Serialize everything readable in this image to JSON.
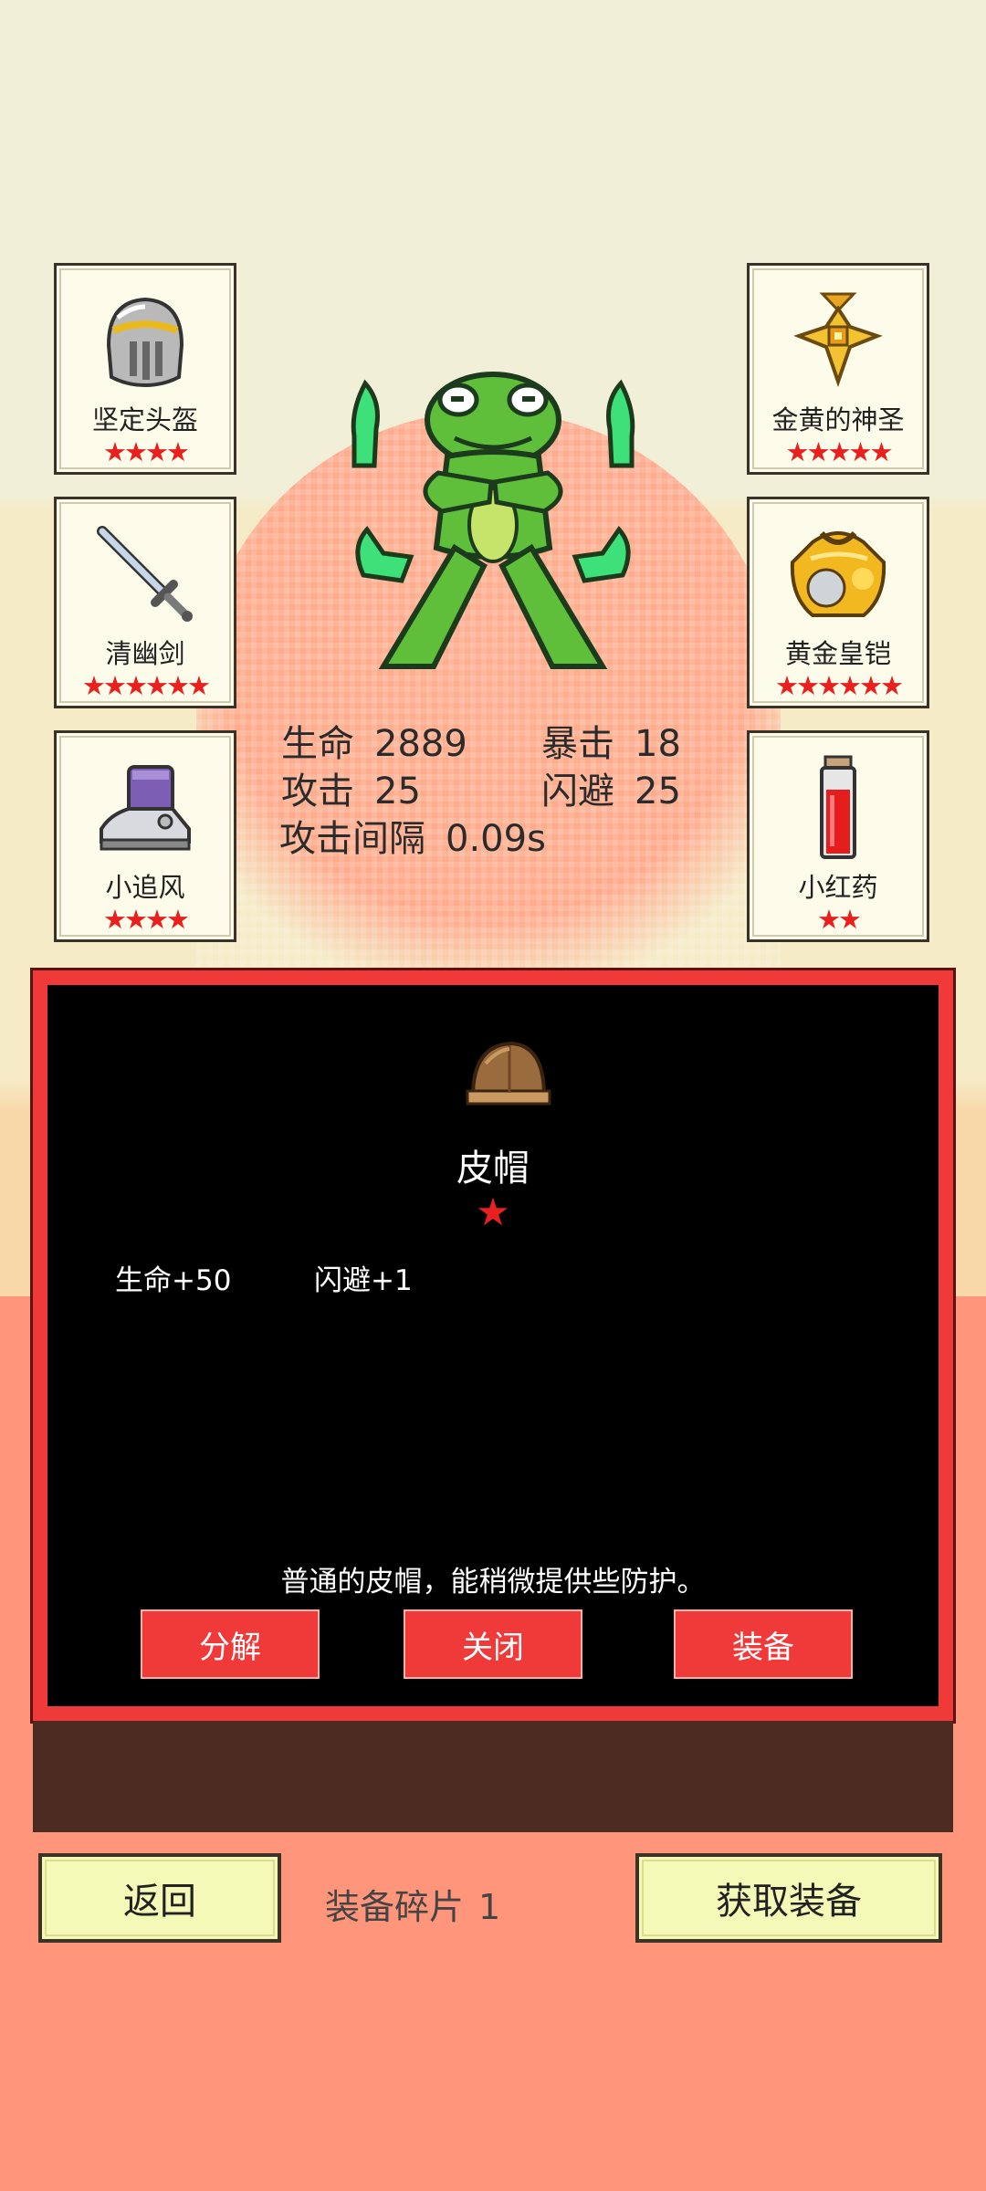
{
  "equipment_left": [
    {
      "name": "坚定头盔",
      "stars": "★★★★",
      "icon": "helmet-icon"
    },
    {
      "name": "清幽剑",
      "stars": "★★★★★★",
      "icon": "sword-icon"
    },
    {
      "name": "小追风",
      "stars": "★★★★",
      "icon": "boot-icon"
    }
  ],
  "equipment_right": [
    {
      "name": "金黄的神圣",
      "stars": "★★★★★",
      "icon": "gold-amulet-icon"
    },
    {
      "name": "黄金皇铠",
      "stars": "★★★★★★",
      "icon": "gold-armor-icon"
    },
    {
      "name": "小红药",
      "stars": "★★",
      "icon": "red-potion-icon"
    }
  ],
  "hero": {
    "icon": "frog-hero-icon"
  },
  "stats": {
    "hp_label": "生命",
    "hp_value": "2889",
    "crit_label": "暴击",
    "crit_value": "18",
    "atk_label": "攻击",
    "atk_value": "25",
    "dodge_label": "闪避",
    "dodge_value": "25",
    "interval_label": "攻击间隔",
    "interval_value": "0.09s"
  },
  "dialog": {
    "item_name": "皮帽",
    "item_icon": "leather-cap-icon",
    "stars": "★",
    "attributes": [
      "生命+50",
      "闪避+1"
    ],
    "description": "普通的皮帽，能稍微提供些防护。",
    "buttons": {
      "decompose": "分解",
      "close": "关闭",
      "equip": "装备"
    }
  },
  "bottom": {
    "back_label": "返回",
    "fragments_label": "装备碎片",
    "fragments_value": "1",
    "get_equipment_label": "获取装备"
  },
  "colors": {
    "accent_red": "#f03a3a",
    "card_bg": "#fdfbea",
    "button_yellow": "#f4f9b8",
    "frog_green": "#5fbf3a"
  }
}
